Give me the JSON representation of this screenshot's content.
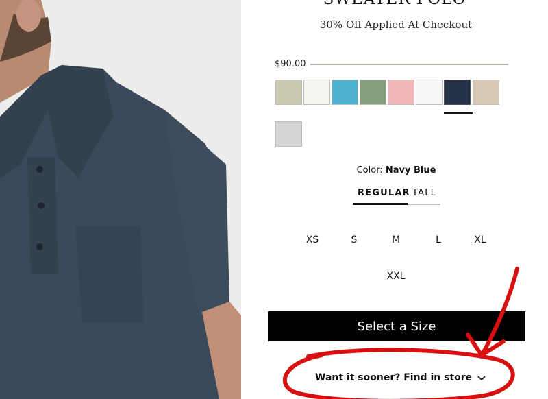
{
  "product": {
    "title": "SWEATER POLO",
    "promo": "30% Off Applied At Checkout",
    "price": "$90.00"
  },
  "swatches": [
    {
      "name": "sage",
      "color": "#c9cab0"
    },
    {
      "name": "ivory",
      "color": "#f6f4ef"
    },
    {
      "name": "teal",
      "color": "#4fb3cf"
    },
    {
      "name": "green",
      "color": "#85a07d"
    },
    {
      "name": "pink",
      "color": "#f2b7b6"
    },
    {
      "name": "white",
      "color": "#f7f7f5"
    },
    {
      "name": "navy",
      "color": "#25324a"
    },
    {
      "name": "tan",
      "color": "#d7c8b4"
    },
    {
      "name": "grey",
      "color": "#d6d6d6"
    }
  ],
  "color": {
    "label": "Color:",
    "value": "Navy Blue"
  },
  "fit_tabs": [
    {
      "label": "REGULAR"
    },
    {
      "label": "TALL"
    }
  ],
  "sizes": [
    {
      "label": "XS"
    },
    {
      "label": "S"
    },
    {
      "label": "M"
    },
    {
      "label": "L"
    },
    {
      "label": "XL"
    },
    {
      "label": "XXL"
    }
  ],
  "cta": {
    "label": "Select a Size"
  },
  "find_store": {
    "label": "Want it sooner? Find in store"
  },
  "accent": {
    "annotation": "#d81010"
  }
}
